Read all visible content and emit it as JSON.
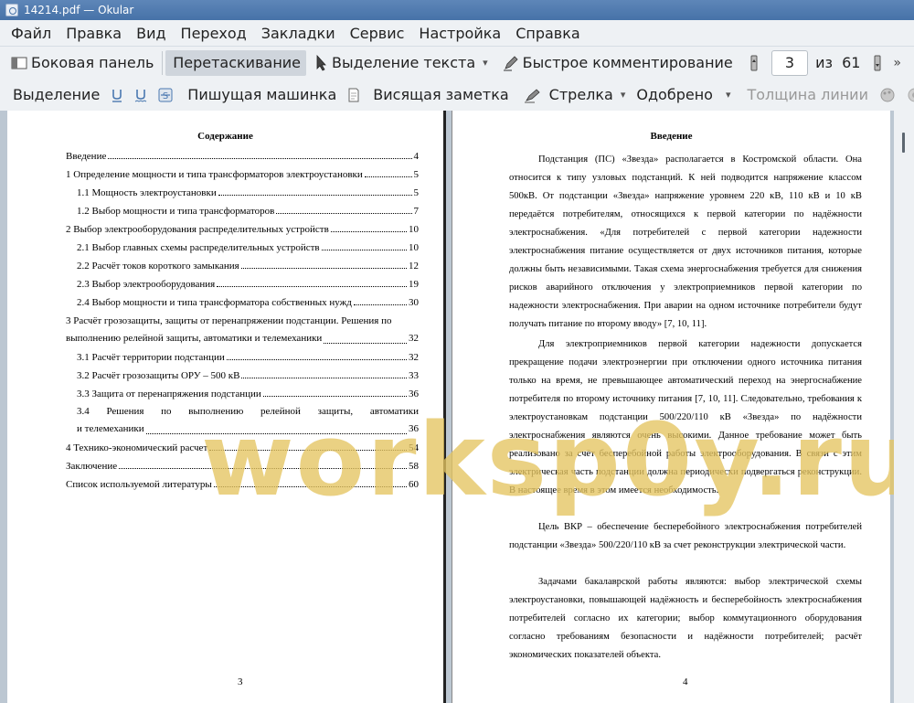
{
  "window": {
    "title": "14214.pdf — Okular"
  },
  "menu": [
    "Файл",
    "Правка",
    "Вид",
    "Переход",
    "Закладки",
    "Сервис",
    "Настройка",
    "Справка"
  ],
  "toolbar1": {
    "sidebar": "Боковая панель",
    "drag": "Перетаскивание",
    "text_select": "Выделение текста",
    "quick_comment": "Быстрое комментирование",
    "page_current": "3",
    "page_of": "из",
    "page_total": "61"
  },
  "toolbar2": {
    "selection": "Выделение",
    "typewriter": "Пишущая машинка",
    "hanging_note": "Висящая заметка",
    "arrow": "Стрелка",
    "approved": "Одобрено",
    "line_width": "Толщина линии"
  },
  "left_page": {
    "title": "Содержание",
    "page_number": "3",
    "toc": [
      {
        "text": "Введение",
        "page": "4"
      },
      {
        "text": "1 Определение мощности и типа трансформаторов электроустановки",
        "page": "5"
      },
      {
        "text": "1.1 Мощность электроустановки",
        "page": "5"
      },
      {
        "text": "1.2 Выбор мощности и типа трансформаторов",
        "page": "7"
      },
      {
        "text": "2 Выбор электрооборудования распределительных устройств",
        "page": "10"
      },
      {
        "text": "2.1 Выбор главных схемы распределительных устройств",
        "page": "10"
      },
      {
        "text": "2.2 Расчёт токов короткого замыкания",
        "page": "12"
      },
      {
        "text": "2.3 Выбор электрооборудования",
        "page": "19"
      },
      {
        "text": "2.4 Выбор мощности и типа трансформатора собственных нужд",
        "page": "30"
      },
      {
        "text_l1": "3 Расчёт грозозащиты, защиты от перенапряжении подстанции. Решения по",
        "text_l2": "выполнению релейной защиты, автоматики и телемеханики",
        "page": "32"
      },
      {
        "text": "3.1 Расчёт территории подстанции",
        "page": "32"
      },
      {
        "text": "3.2 Расчёт грозозащиты ОРУ – 500 кВ",
        "page": "33"
      },
      {
        "text": "3.3 Защита от перенапряжения подстанции",
        "page": "36"
      },
      {
        "text_l1": "3.4 Решения по выполнению релейной защиты, автоматики",
        "text_l2": "и телемеханики",
        "page": "36"
      },
      {
        "text": "4 Технико-экономический расчет",
        "page": "54"
      },
      {
        "text": "Заключение",
        "page": "58"
      },
      {
        "text": "Список используемой литературы",
        "page": "60"
      }
    ]
  },
  "right_page": {
    "title": "Введение",
    "page_number": "4",
    "paragraphs": [
      "Подстанция (ПС) «Звезда» располагается в Костромской области. Она относится к типу узловых подстанций. К ней подводится напряжение классом 500кВ. От подстанции «Звезда» напряжение уровнем 220 кВ, 110 кВ и 10 кВ передаётся потребителям, относящихся к первой категории по надёжности электроснабжения. «Для потребителей с первой категории надежности электроснабжения питание осуществляется от двух источников питания, которые должны быть независимыми. Такая схема энергоснабжения требуется для снижения рисков аварийного отключения у электроприемников первой категории по надежности электроснабжения. При аварии на одном источнике потребители будут получать питание по второму вводу» [7, 10, 11].",
      "Для электроприемников первой категории надежности допускается прекращение подачи электроэнергии при отключении одного источника питания только на время, не превышающее автоматический переход на энергоснабжение потребителя по второму источнику питания [7, 10, 11]. Следовательно, требования к электроустановкам подстанции 500/220/110 кВ «Звезда» по надёжности электроснабжения являются очень высокими. Данное требование может быть реализовано за счёт бесперебойной работы электрооборудования. В связи с этим электрическая часть подстанции должна периодически подвергаться реконструкции. В настоящее время в этом имеется необходимость.",
      "Цель ВКР – обеспечение бесперебойного электроснабжения потребителей подстанции «Звезда» 500/220/110 кВ за счет реконструкции электрической части.",
      "Задачами бакалаврской работы являются: выбор электрической схемы электроустановки, повышающей надёжность и бесперебойность электроснабжения потребителей согласно их категории; выбор коммутационного оборудования согласно требованиям безопасности и надёжности потребителей; расчёт экономических показателей объекта."
    ]
  },
  "watermark": "worksp0y.ru"
}
